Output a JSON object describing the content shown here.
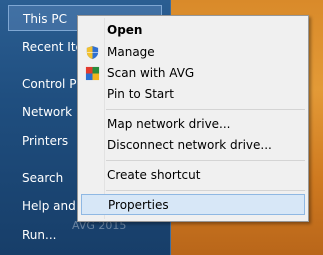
{
  "start_menu": {
    "items": [
      {
        "label": "This PC",
        "selected": true
      },
      {
        "label": "Recent Ite"
      },
      {
        "label": "Control P"
      },
      {
        "label": "Network"
      },
      {
        "label": "Printers"
      },
      {
        "label": "Search"
      },
      {
        "label": "Help and"
      },
      {
        "label": "Run..."
      }
    ],
    "ghost_text": "AVG 2015"
  },
  "context_menu": {
    "items": [
      {
        "label": "Open",
        "bold": true
      },
      {
        "label": "Manage",
        "icon": "shield-icon"
      },
      {
        "label": "Scan with AVG",
        "icon": "avg-icon"
      },
      {
        "label": "Pin to Start"
      },
      {
        "label": "Map network drive..."
      },
      {
        "label": "Disconnect network drive..."
      },
      {
        "label": "Create shortcut"
      },
      {
        "label": "Properties",
        "hover": true
      }
    ]
  },
  "colors": {
    "start_pane": "#1f4e7f",
    "desktop": "#d98a2a",
    "menu_bg": "#f0f0f0",
    "menu_hover": "#d7e7f7"
  }
}
